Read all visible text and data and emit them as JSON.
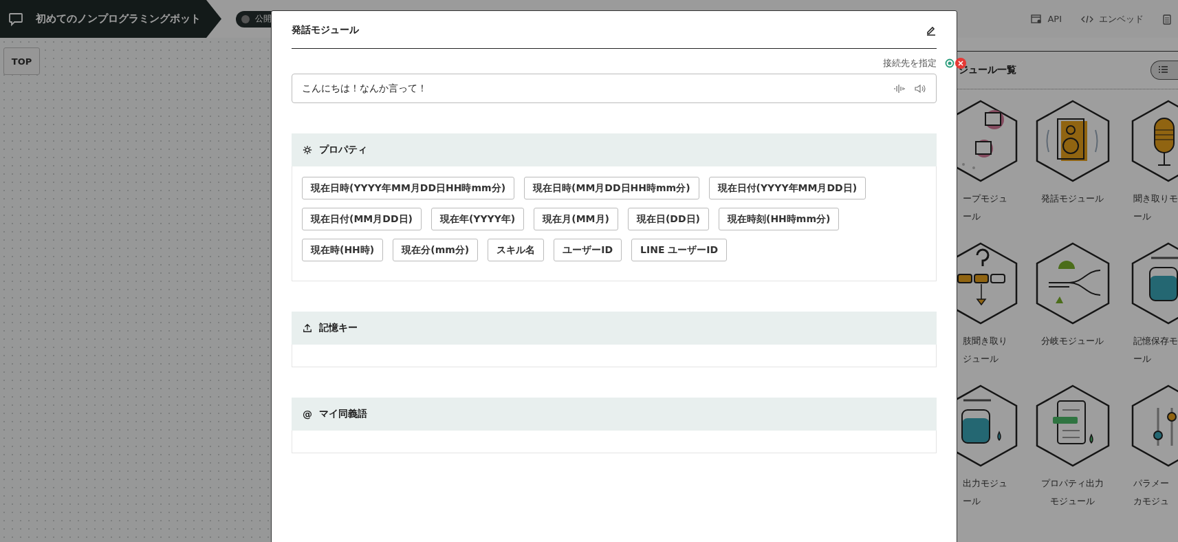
{
  "header": {
    "bot_name": "初めてのノンプログラミングボット",
    "status": "公開"
  },
  "top_links": [
    {
      "kind": "api",
      "label": "API"
    },
    {
      "kind": "embed",
      "label": "エンベッド"
    },
    {
      "kind": "clipboard"
    }
  ],
  "canvas": {
    "top_button": "TOP"
  },
  "module_panel": {
    "title": "ジュール一覧",
    "modules": [
      {
        "lines": [
          "ープモジュ",
          "ール"
        ]
      },
      {
        "lines": [
          "発話モジュール"
        ]
      },
      {
        "lines": [
          "聞き取りモ",
          "ール"
        ]
      },
      {
        "lines": [
          "肢聞き取り",
          "ジュール"
        ]
      },
      {
        "lines": [
          "分岐モジュール"
        ]
      },
      {
        "lines": [
          "記憶保存モ",
          "ール"
        ]
      },
      {
        "lines": [
          "出力モジュ",
          "ール"
        ]
      },
      {
        "lines": [
          "プロパティ出力",
          "モジュール"
        ]
      },
      {
        "lines": [
          "パラメー",
          "カモジュ"
        ]
      }
    ]
  },
  "modal": {
    "title": "発話モジュール",
    "connect_label": "接続先を指定",
    "utterance": "こんにちは！なんか言って！",
    "sections": [
      {
        "kind": "properties",
        "title": "プロパティ",
        "tags": [
          "現在日時(YYYY年MM月DD日HH時mm分)",
          "現在日時(MM月DD日HH時mm分)",
          "現在日付(YYYY年MM月DD日)",
          "現在日付(MM月DD日)",
          "現在年(YYYY年)",
          "現在月(MM月)",
          "現在日(DD日)",
          "現在時刻(HH時mm分)",
          "現在時(HH時)",
          "現在分(mm分)",
          "スキル名",
          "ユーザーID",
          "LINE ユーザーID"
        ]
      },
      {
        "kind": "memory",
        "title": "記憶キー"
      },
      {
        "kind": "synonyms",
        "title": "マイ同義語",
        "icon_glyph": "@"
      }
    ]
  }
}
